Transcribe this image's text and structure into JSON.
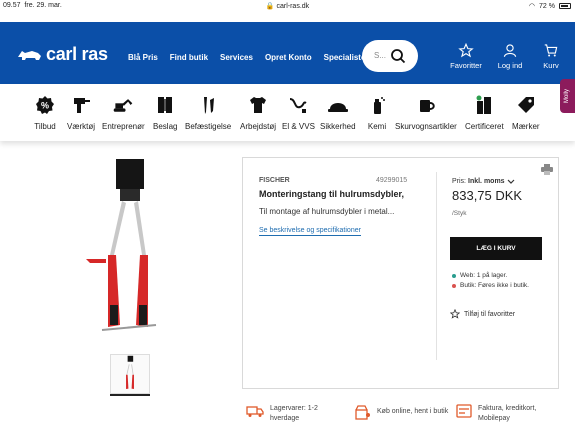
{
  "status_bar": {
    "time": "09.57",
    "date": "fre. 29. mar.",
    "url": "carl-ras.dk",
    "battery": "72 %"
  },
  "header": {
    "logo_text": "carl ras",
    "nav": [
      "Blå Pris",
      "Find butik",
      "Services",
      "Opret Konto",
      "Specialisten"
    ],
    "search_placeholder": "S...",
    "actions": [
      {
        "label": "Favoritter",
        "icon": "star-icon"
      },
      {
        "label": "Log ind",
        "icon": "user-icon"
      },
      {
        "label": "Kurv",
        "icon": "cart-icon"
      }
    ],
    "brand_color": "#0b4fa8"
  },
  "side_tab": "Molly",
  "categories": [
    {
      "label": "Tilbud",
      "icon": "percent-badge-icon"
    },
    {
      "label": "Værktøj",
      "icon": "drill-icon"
    },
    {
      "label": "Entreprenør",
      "icon": "excavator-icon"
    },
    {
      "label": "Beslag",
      "icon": "hinge-icon"
    },
    {
      "label": "Befæstigelse",
      "icon": "screws-icon"
    },
    {
      "label": "Arbejdstøj",
      "icon": "shirt-icon"
    },
    {
      "label": "El & VVS",
      "icon": "cable-icon"
    },
    {
      "label": "Sikkerhed",
      "icon": "helmet-icon"
    },
    {
      "label": "Kemi",
      "icon": "spray-can-icon"
    },
    {
      "label": "Skurvognsartikler",
      "icon": "mug-icon"
    },
    {
      "label": "Certificeret",
      "icon": "building-icon"
    },
    {
      "label": "Mærker",
      "icon": "tag-icon"
    }
  ],
  "product": {
    "brand": "FISCHER",
    "sku": "49299015",
    "title": "Monteringstang til hulrumsdybler,",
    "description": "Til montage af hulrumsdybler i metal...",
    "details_link": "Se beskrivelse og specifikationer",
    "price_label": "Pris:",
    "price_mode": "Inkl. moms",
    "price": "833,75 DKK",
    "unit": "/Styk",
    "add_to_cart": "LÆG I KURV",
    "stock": [
      {
        "text": "Web: 1 på lager.",
        "color": "#2a9d8f"
      },
      {
        "text": "Butik: Føres ikke i butik.",
        "color": "#d9534f"
      }
    ],
    "favorite": "Tilføj til favoritter"
  },
  "features": [
    {
      "text": "Lagervarer: 1-2 hverdage",
      "icon": "truck-icon"
    },
    {
      "text": "Køb online, hent i butik",
      "icon": "store-pin-icon"
    },
    {
      "text": "Faktura, kreditkort, Mobilepay",
      "icon": "invoice-icon"
    }
  ]
}
